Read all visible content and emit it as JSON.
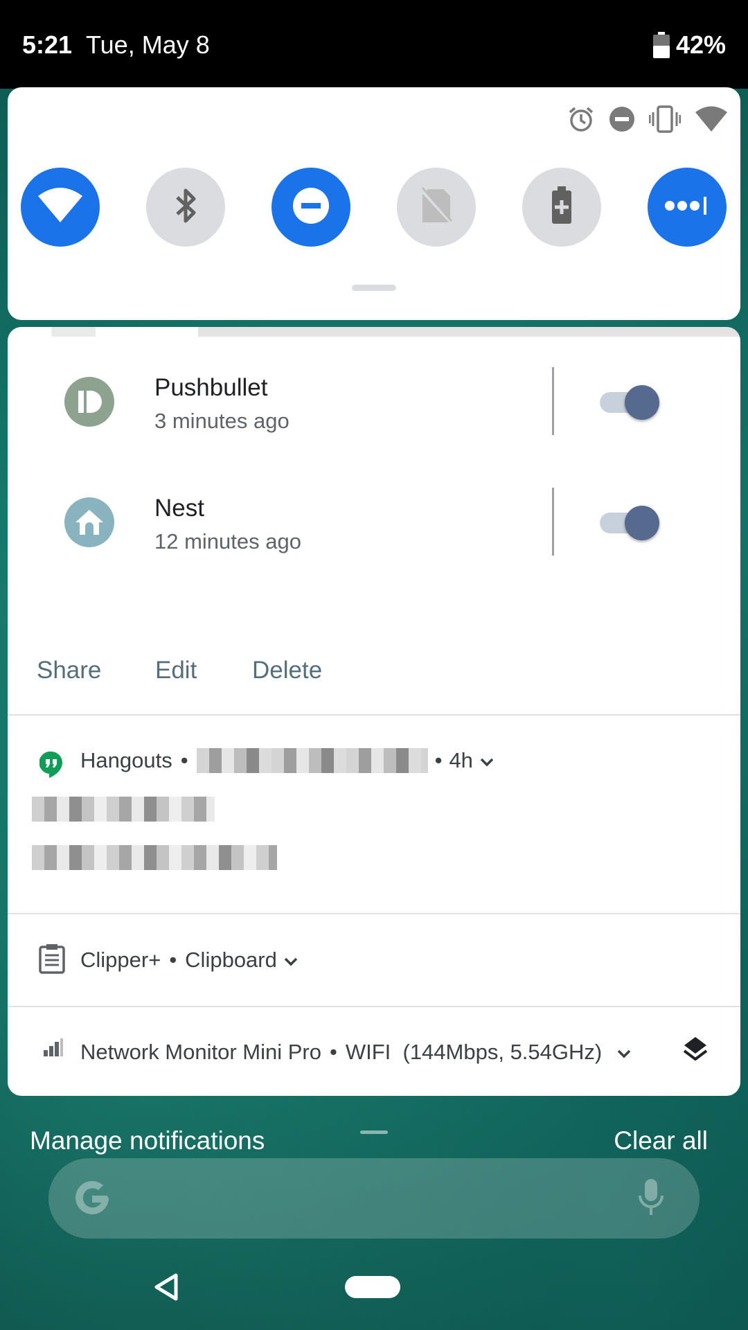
{
  "status_bar": {
    "time": "5:21",
    "date": "Tue, May 8",
    "battery": "42%",
    "battery_icon": "battery-icon"
  },
  "quick_settings": {
    "status_icons": [
      "alarm-icon",
      "do-not-disturb-icon",
      "vibrate-icon",
      "wifi-signal-icon"
    ],
    "tiles": [
      {
        "name": "wifi",
        "icon": "wifi-icon",
        "state": "on"
      },
      {
        "name": "bluetooth",
        "icon": "bluetooth-icon",
        "state": "off"
      },
      {
        "name": "do-not-disturb",
        "icon": "do-not-disturb-icon",
        "state": "on"
      },
      {
        "name": "no-sim",
        "icon": "no-sim-icon",
        "state": "off"
      },
      {
        "name": "battery-saver",
        "icon": "battery-saver-icon",
        "state": "off"
      },
      {
        "name": "more",
        "icon": "more-icon",
        "state": "on"
      }
    ],
    "accent_color": "#1a73e8"
  },
  "notifications": {
    "apps": [
      {
        "name": "Pushbullet",
        "time": "3 minutes ago",
        "toggle_on": true
      },
      {
        "name": "Nest",
        "time": "12 minutes ago",
        "toggle_on": true
      }
    ],
    "actions": {
      "share": "Share",
      "edit": "Edit",
      "delete": "Delete"
    },
    "hangouts": {
      "app": "Hangouts",
      "separator": "•",
      "time": "4h"
    },
    "clipper": {
      "app": "Clipper+",
      "separator": "•",
      "detail": "Clipboard"
    },
    "network": {
      "app": "Network Monitor Mini Pro",
      "separator": "•",
      "detail": "WIFI  (144Mbps, 5.54GHz)"
    }
  },
  "footer": {
    "manage": "Manage notifications",
    "clear": "Clear all"
  }
}
